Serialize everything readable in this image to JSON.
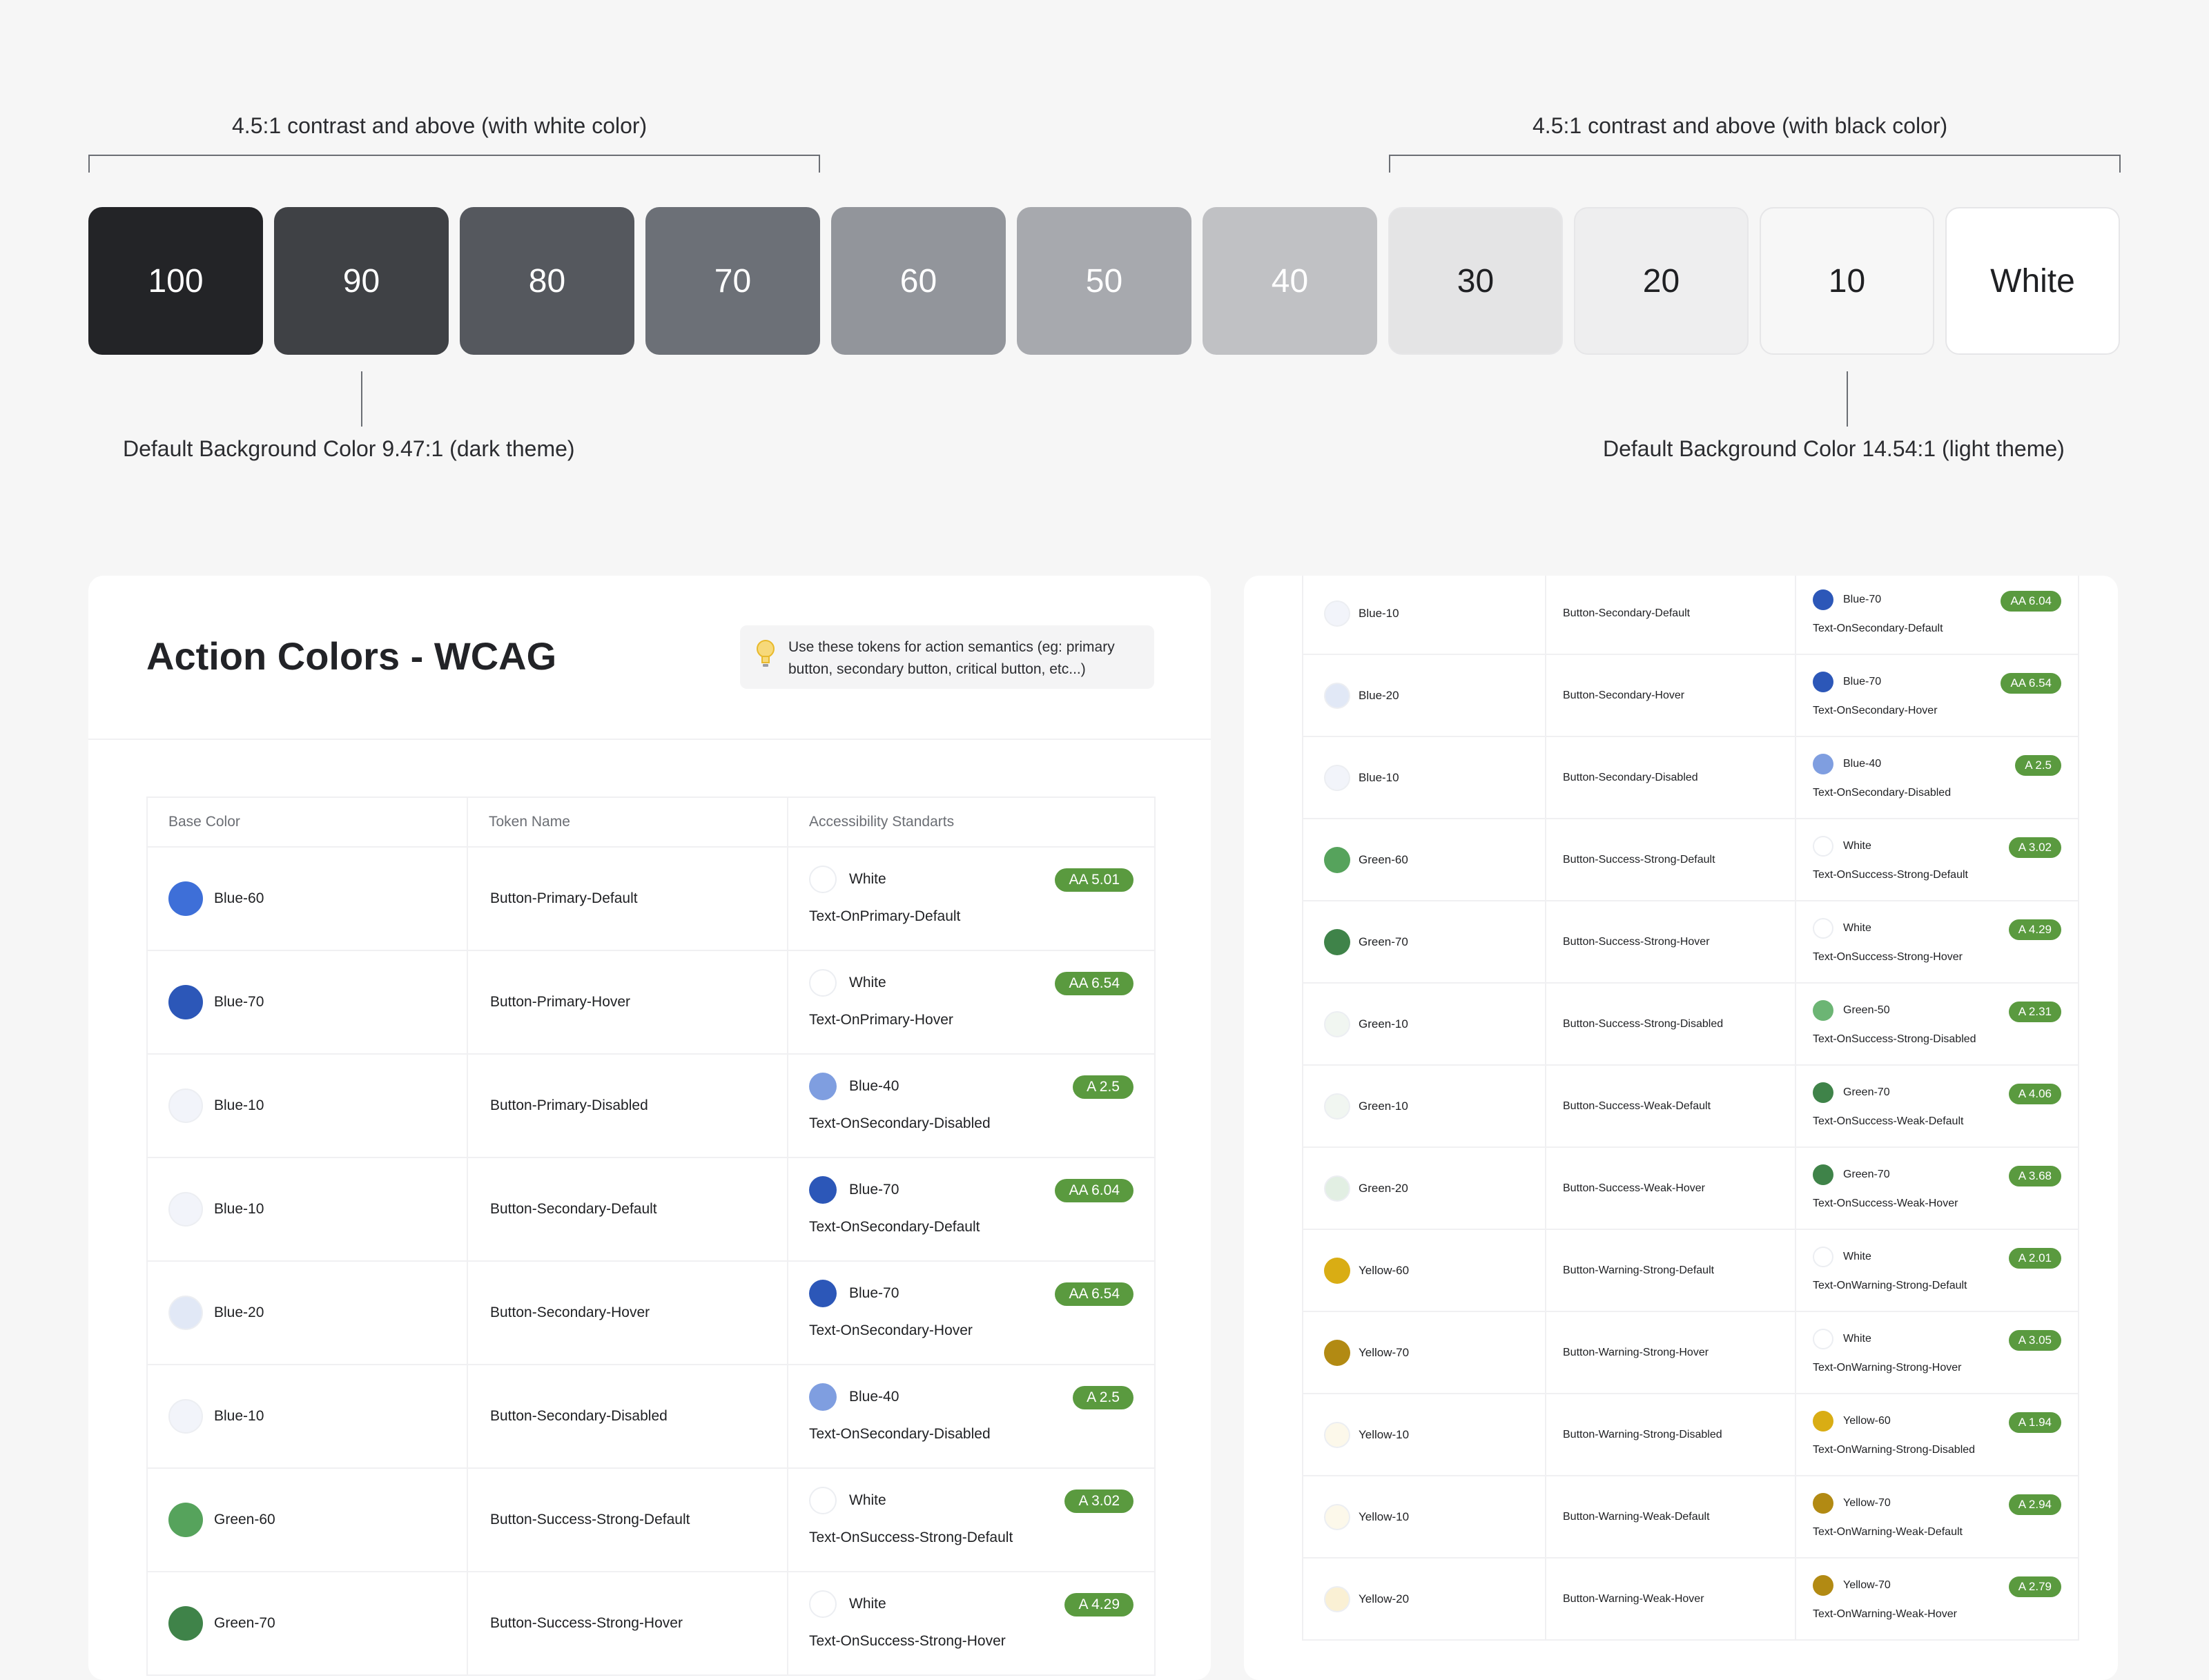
{
  "grey_scale": {
    "label_white": "4.5:1 contrast and above (with white color)",
    "label_black": "4.5:1 contrast and above (with black color)",
    "note_dark": "Default Background Color 9.47:1 (dark theme)",
    "note_light": "Default Background Color 14.54:1 (light theme)",
    "swatches": [
      {
        "label": "100",
        "color": "#232427",
        "text_color": "#ffffff"
      },
      {
        "label": "90",
        "color": "#3f4145",
        "text_color": "#ffffff"
      },
      {
        "label": "80",
        "color": "#55585e",
        "text_color": "#ffffff"
      },
      {
        "label": "70",
        "color": "#6c7077",
        "text_color": "#ffffff"
      },
      {
        "label": "60",
        "color": "#92959b",
        "text_color": "#ffffff"
      },
      {
        "label": "50",
        "color": "#a7a9ae",
        "text_color": "#ffffff"
      },
      {
        "label": "40",
        "color": "#c0c1c4",
        "text_color": "#ffffff"
      },
      {
        "label": "30",
        "color": "#e4e4e5",
        "text_color": "#1f2023"
      },
      {
        "label": "20",
        "color": "#eeeeef",
        "text_color": "#1f2023"
      },
      {
        "label": "10",
        "color": "#f7f7f7",
        "text_color": "#1f2023"
      },
      {
        "label": "White",
        "color": "#ffffff",
        "text_color": "#1f2023"
      }
    ]
  },
  "action_colors": {
    "title": "Action Colors - WCAG",
    "tip": "Use these tokens for action semantics (eg: primary button, secondary button, critical button, etc...)",
    "tip_icon": "lightbulb-icon",
    "columns": [
      "Base Color",
      "Token Name",
      "Accessibility Standarts"
    ],
    "rows": [
      {
        "base": "Blue-60",
        "base_color": "#3e6fd8",
        "token": "Button-Primary-Default",
        "acc_name": "White",
        "acc_color": "#ffffff",
        "badge": "AA 5.01",
        "text_token": "Text-OnPrimary-Default"
      },
      {
        "base": "Blue-70",
        "base_color": "#2c57b8",
        "token": "Button-Primary-Hover",
        "acc_name": "White",
        "acc_color": "#ffffff",
        "badge": "AA 6.54",
        "text_token": "Text-OnPrimary-Hover"
      },
      {
        "base": "Blue-10",
        "base_color": "#f2f4fa",
        "token": "Button-Primary-Disabled",
        "acc_name": "Blue-40",
        "acc_color": "#7f9ee0",
        "badge": "A 2.5",
        "text_token": "Text-OnSecondary-Disabled"
      },
      {
        "base": "Blue-10",
        "base_color": "#f2f4fa",
        "token": "Button-Secondary-Default",
        "acc_name": "Blue-70",
        "acc_color": "#2c57b8",
        "badge": "AA 6.04",
        "text_token": "Text-OnSecondary-Default"
      },
      {
        "base": "Blue-20",
        "base_color": "#e1e8f6",
        "token": "Button-Secondary-Hover",
        "acc_name": "Blue-70",
        "acc_color": "#2c57b8",
        "badge": "AA 6.54",
        "text_token": "Text-OnSecondary-Hover"
      },
      {
        "base": "Blue-10",
        "base_color": "#f2f4fa",
        "token": "Button-Secondary-Disabled",
        "acc_name": "Blue-40",
        "acc_color": "#7f9ee0",
        "badge": "A 2.5",
        "text_token": "Text-OnSecondary-Disabled"
      },
      {
        "base": "Green-60",
        "base_color": "#56a35c",
        "token": "Button-Success-Strong-Default",
        "acc_name": "White",
        "acc_color": "#ffffff",
        "badge": "A 3.02",
        "text_token": "Text-OnSuccess-Strong-Default"
      },
      {
        "base": "Green-70",
        "base_color": "#3f8349",
        "token": "Button-Success-Strong-Hover",
        "acc_name": "White",
        "acc_color": "#ffffff",
        "badge": "A 4.29",
        "text_token": "Text-OnSuccess-Strong-Hover"
      }
    ],
    "rows_continued": [
      {
        "base": "Blue-10",
        "base_color": "#f2f4fa",
        "token": "Button-Secondary-Default",
        "acc_name": "Blue-70",
        "acc_color": "#2c57b8",
        "badge": "AA 6.04",
        "text_token": "Text-OnSecondary-Default"
      },
      {
        "base": "Blue-20",
        "base_color": "#e1e8f6",
        "token": "Button-Secondary-Hover",
        "acc_name": "Blue-70",
        "acc_color": "#2c57b8",
        "badge": "AA 6.54",
        "text_token": "Text-OnSecondary-Hover"
      },
      {
        "base": "Blue-10",
        "base_color": "#f2f4fa",
        "token": "Button-Secondary-Disabled",
        "acc_name": "Blue-40",
        "acc_color": "#7f9ee0",
        "badge": "A 2.5",
        "text_token": "Text-OnSecondary-Disabled"
      },
      {
        "base": "Green-60",
        "base_color": "#56a35c",
        "token": "Button-Success-Strong-Default",
        "acc_name": "White",
        "acc_color": "#ffffff",
        "badge": "A 3.02",
        "text_token": "Text-OnSuccess-Strong-Default"
      },
      {
        "base": "Green-70",
        "base_color": "#3f8349",
        "token": "Button-Success-Strong-Hover",
        "acc_name": "White",
        "acc_color": "#ffffff",
        "badge": "A 4.29",
        "text_token": "Text-OnSuccess-Strong-Hover"
      },
      {
        "base": "Green-10",
        "base_color": "#f1f6f1",
        "token": "Button-Success-Strong-Disabled",
        "acc_name": "Green-50",
        "acc_color": "#6cb574",
        "badge": "A 2.31",
        "text_token": "Text-OnSuccess-Strong-Disabled"
      },
      {
        "base": "Green-10",
        "base_color": "#f1f6f1",
        "token": "Button-Success-Weak-Default",
        "acc_name": "Green-70",
        "acc_color": "#3f8349",
        "badge": "A 4.06",
        "text_token": "Text-OnSuccess-Weak-Default"
      },
      {
        "base": "Green-20",
        "base_color": "#e2efe3",
        "token": "Button-Success-Weak-Hover",
        "acc_name": "Green-70",
        "acc_color": "#3f8349",
        "badge": "A 3.68",
        "text_token": "Text-OnSuccess-Weak-Hover"
      },
      {
        "base": "Yellow-60",
        "base_color": "#d9ad14",
        "token": "Button-Warning-Strong-Default",
        "acc_name": "White",
        "acc_color": "#ffffff",
        "badge": "A 2.01",
        "text_token": "Text-OnWarning-Strong-Default"
      },
      {
        "base": "Yellow-70",
        "base_color": "#b28a13",
        "token": "Button-Warning-Strong-Hover",
        "acc_name": "White",
        "acc_color": "#ffffff",
        "badge": "A 3.05",
        "text_token": "Text-OnWarning-Strong-Hover"
      },
      {
        "base": "Yellow-10",
        "base_color": "#fcf8ea",
        "token": "Button-Warning-Strong-Disabled",
        "acc_name": "Yellow-60",
        "acc_color": "#d9ad14",
        "badge": "A 1.94",
        "text_token": "Text-OnWarning-Strong-Disabled"
      },
      {
        "base": "Yellow-10",
        "base_color": "#fcf8ea",
        "token": "Button-Warning-Weak-Default",
        "acc_name": "Yellow-70",
        "acc_color": "#b28a13",
        "badge": "A 2.94",
        "text_token": "Text-OnWarning-Weak-Default"
      },
      {
        "base": "Yellow-20",
        "base_color": "#faf0d4",
        "token": "Button-Warning-Weak-Hover",
        "acc_name": "Yellow-70",
        "acc_color": "#b28a13",
        "badge": "A 2.79",
        "text_token": "Text-OnWarning-Weak-Hover"
      }
    ]
  },
  "colors": {
    "page_background": "#f6f6f6",
    "card_background": "#ffffff",
    "badge_green": "#5a9a3f",
    "line_grey": "#6b6e74"
  }
}
